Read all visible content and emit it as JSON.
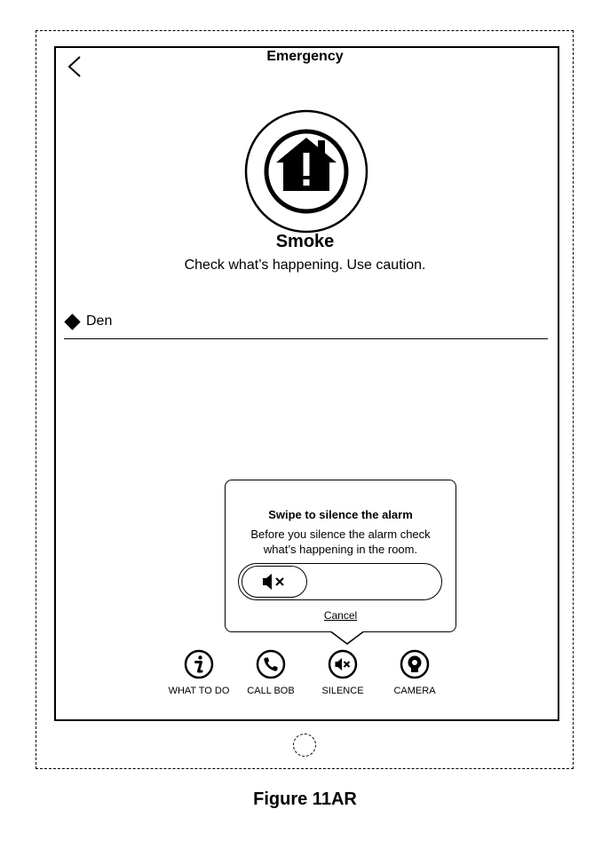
{
  "screen": {
    "title": "Emergency",
    "headline": "Smoke",
    "subline": "Check what’s happening. Use caution.",
    "room_label": "Den"
  },
  "popup": {
    "title": "Swipe to silence the alarm",
    "body_line1": "Before you silence the alarm check",
    "body_line2": "what’s happening in the room.",
    "cancel_label": "Cancel"
  },
  "actions": [
    {
      "label": "WHAT TO DO",
      "icon": "info-icon"
    },
    {
      "label": "CALL BOB",
      "icon": "phone-icon"
    },
    {
      "label": "SILENCE",
      "icon": "mute-icon"
    },
    {
      "label": "CAMERA",
      "icon": "camera-icon"
    }
  ],
  "figure_caption": "Figure 11AR"
}
